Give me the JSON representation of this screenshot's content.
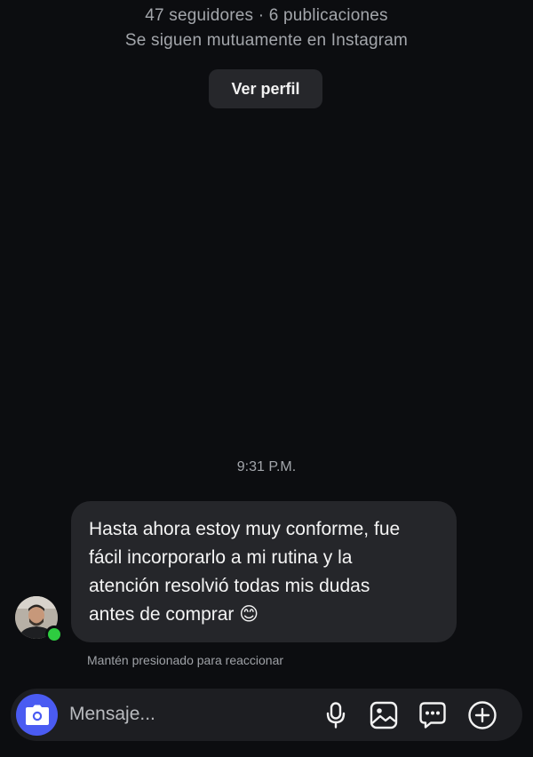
{
  "profile": {
    "stats": "47 seguidores · 6 publicaciones",
    "mutual": "Se siguen mutuamente en Instagram",
    "view_profile_label": "Ver perfil"
  },
  "conversation": {
    "timestamp": "9:31 P.M.",
    "message_lines": [
      "Hasta ahora estoy muy conforme, fue",
      "fácil incorporarlo a mi rutina y la",
      "atención resolvió todas mis dudas",
      "antes de comprar 😊"
    ],
    "reaction_hint": "Mantén presionado para reaccionar"
  },
  "composer": {
    "placeholder": "Mensaje...",
    "icons": [
      "camera-icon",
      "microphone-icon",
      "gallery-icon",
      "sticker-icon",
      "add-icon"
    ]
  },
  "colors": {
    "background": "#0c0d10",
    "bubble": "#25262a",
    "accent": "#4a5bf2",
    "online": "#2ecc40"
  }
}
